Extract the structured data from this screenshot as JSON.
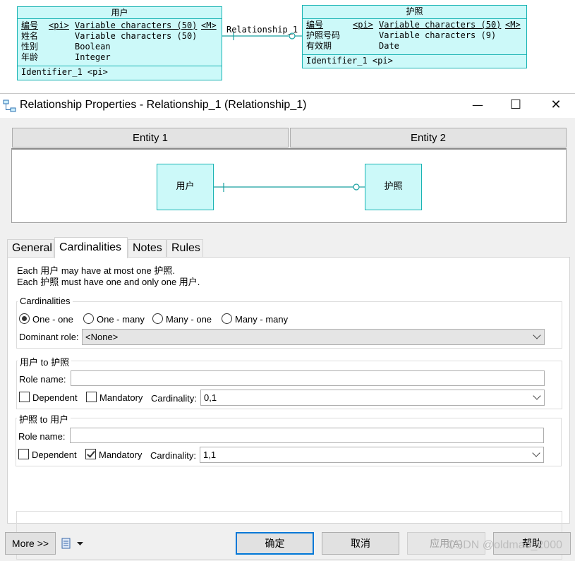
{
  "diagram": {
    "entity1": {
      "title": "用户",
      "attributes": [
        {
          "name": "编号",
          "key": "<pi>",
          "type": "Variable characters (50)",
          "mandatory": "<M>",
          "underline": true
        },
        {
          "name": "姓名",
          "key": "",
          "type": "Variable characters (50)",
          "mandatory": "",
          "underline": false
        },
        {
          "name": "性别",
          "key": "",
          "type": "Boolean",
          "mandatory": "",
          "underline": false
        },
        {
          "name": "年龄",
          "key": "",
          "type": "Integer",
          "mandatory": "",
          "underline": false
        }
      ],
      "identifier": "Identifier_1  <pi>"
    },
    "entity2": {
      "title": "护照",
      "attributes": [
        {
          "name": "编号",
          "key": "<pi>",
          "type": "Variable characters (50)",
          "mandatory": "<M>",
          "underline": true
        },
        {
          "name": "护照号码",
          "key": "",
          "type": "Variable characters (9)",
          "mandatory": "",
          "underline": false
        },
        {
          "name": "有效期",
          "key": "",
          "type": "Date",
          "mandatory": "",
          "underline": false
        }
      ],
      "identifier": "Identifier_1  <pi>"
    },
    "relationship_label": "Relationship_1"
  },
  "dialog": {
    "title": "Relationship Properties - Relationship_1 (Relationship_1)",
    "minimize": "—",
    "maximize": "☐",
    "close": "✕",
    "entity_tabs": [
      "Entity 1",
      "Entity 2"
    ],
    "preview": {
      "entity1": "用户",
      "entity2": "护照"
    },
    "tabs": [
      "General",
      "Cardinalities",
      "Notes",
      "Rules"
    ],
    "active_tab": "Cardinalities",
    "description": [
      "Each 用户 may have at most one 护照.",
      "Each 护照 must have one and only one 用户."
    ],
    "cardinalities": {
      "group_label": "Cardinalities",
      "options": [
        "One - one",
        "One - many",
        "Many - one",
        "Many - many"
      ],
      "selected": "One - one",
      "dominant_role_label": "Dominant role:",
      "dominant_role_value": "<None>"
    },
    "role1": {
      "group_label": "用户 to 护照",
      "role_name_label": "Role name:",
      "role_name_value": "",
      "dependent_label": "Dependent",
      "dependent": false,
      "mandatory_label": "Mandatory",
      "mandatory": false,
      "cardinality_label": "Cardinality:",
      "cardinality_value": "0,1"
    },
    "role2": {
      "group_label": "护照 to 用户",
      "role_name_label": "Role name:",
      "role_name_value": "",
      "dependent_label": "Dependent",
      "dependent": false,
      "mandatory_label": "Mandatory",
      "mandatory": true,
      "cardinality_label": "Cardinality:",
      "cardinality_value": "1,1"
    },
    "buttons": {
      "more": "More >>",
      "ok": "确定",
      "cancel": "取消",
      "apply": "应用(A)",
      "help": "帮助"
    },
    "watermark": "CSDN @oldmao_2000"
  },
  "colors": {
    "entity_fill": "#ccf9f9",
    "entity_border": "#19b3b3",
    "default_button_border": "#0078d7"
  },
  "icons": [
    "relationship-icon",
    "properties-menu-icon",
    "dropdown-arrow-icon"
  ]
}
